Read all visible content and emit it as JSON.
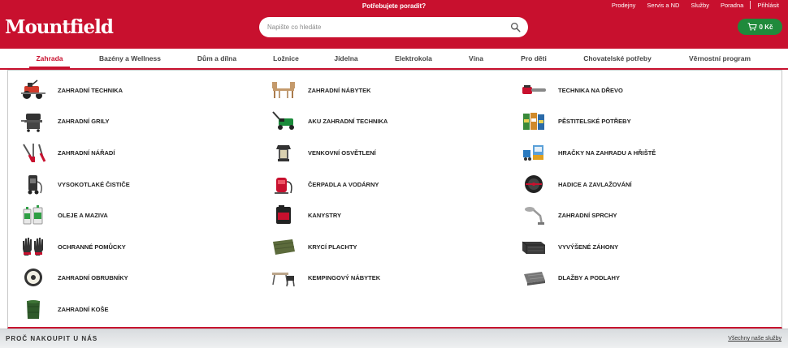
{
  "header": {
    "help_text": "Potřebujete poradit?",
    "logo_text": "Mountfield",
    "search_placeholder": "Napište co hledáte",
    "top_links": [
      "Prodejny",
      "Servis a ND",
      "Služby",
      "Poradna"
    ],
    "login_label": "Přihlásit",
    "cart_label": "0 Kč",
    "brand_color": "#c8102e",
    "cart_color": "#1f8a3b"
  },
  "nav": {
    "items": [
      "Zahrada",
      "Bazény a Wellness",
      "Dům a dílna",
      "Ložnice",
      "Jídelna",
      "Elektrokola",
      "Vína",
      "Pro děti",
      "Chovatelské potřeby",
      "Věrnostní program"
    ],
    "active": "Zahrada"
  },
  "categories": {
    "col1": [
      {
        "label": "ZAHRADNÍ TECHNIKA",
        "icon": "lawn-tractor-icon"
      },
      {
        "label": "ZAHRADNÍ GRILY",
        "icon": "grill-icon"
      },
      {
        "label": "ZAHRADNÍ NÁŘADÍ",
        "icon": "garden-tools-icon"
      },
      {
        "label": "VYSOKOTLAKÉ ČISTIČE",
        "icon": "pressure-washer-icon"
      },
      {
        "label": "OLEJE A MAZIVA",
        "icon": "oil-bottles-icon"
      },
      {
        "label": "OCHRANNÉ POMŮCKY",
        "icon": "gloves-icon"
      },
      {
        "label": "ZAHRADNÍ OBRUBNÍKY",
        "icon": "edging-roll-icon"
      },
      {
        "label": "ZAHRADNÍ KOŠE",
        "icon": "garden-basket-icon"
      }
    ],
    "col2": [
      {
        "label": "ZAHRADNÍ NÁBYTEK",
        "icon": "garden-furniture-icon"
      },
      {
        "label": "AKU ZAHRADNÍ TECHNIKA",
        "icon": "battery-mower-icon"
      },
      {
        "label": "VENKOVNÍ OSVĚTLENÍ",
        "icon": "outdoor-lamp-icon"
      },
      {
        "label": "ČERPADLA A VODÁRNY",
        "icon": "water-pump-icon"
      },
      {
        "label": "KANYSTRY",
        "icon": "canister-icon"
      },
      {
        "label": "KRYCÍ PLACHTY",
        "icon": "tarp-icon"
      },
      {
        "label": "KEMPINGOVÝ NÁBYTEK",
        "icon": "camping-furniture-icon"
      }
    ],
    "col3": [
      {
        "label": "TECHNIKA NA DŘEVO",
        "icon": "chainsaw-icon"
      },
      {
        "label": "PĚSTITELSKÉ POTŘEBY",
        "icon": "fertilizer-bags-icon"
      },
      {
        "label": "HRAČKY NA ZAHRADU A HŘIŠTĚ",
        "icon": "playground-toys-icon"
      },
      {
        "label": "HADICE A ZAVLAŽOVÁNÍ",
        "icon": "hose-reel-icon"
      },
      {
        "label": "ZAHRADNÍ SPRCHY",
        "icon": "garden-shower-icon"
      },
      {
        "label": "VYVÝŠENÉ ZÁHONY",
        "icon": "raised-bed-icon"
      },
      {
        "label": "DLAŽBY A PODLAHY",
        "icon": "paving-tile-icon"
      }
    ]
  },
  "footer": {
    "why_label": "PROČ NAKOUPIT U NÁS",
    "all_services_label": "Všechny naše služby"
  }
}
